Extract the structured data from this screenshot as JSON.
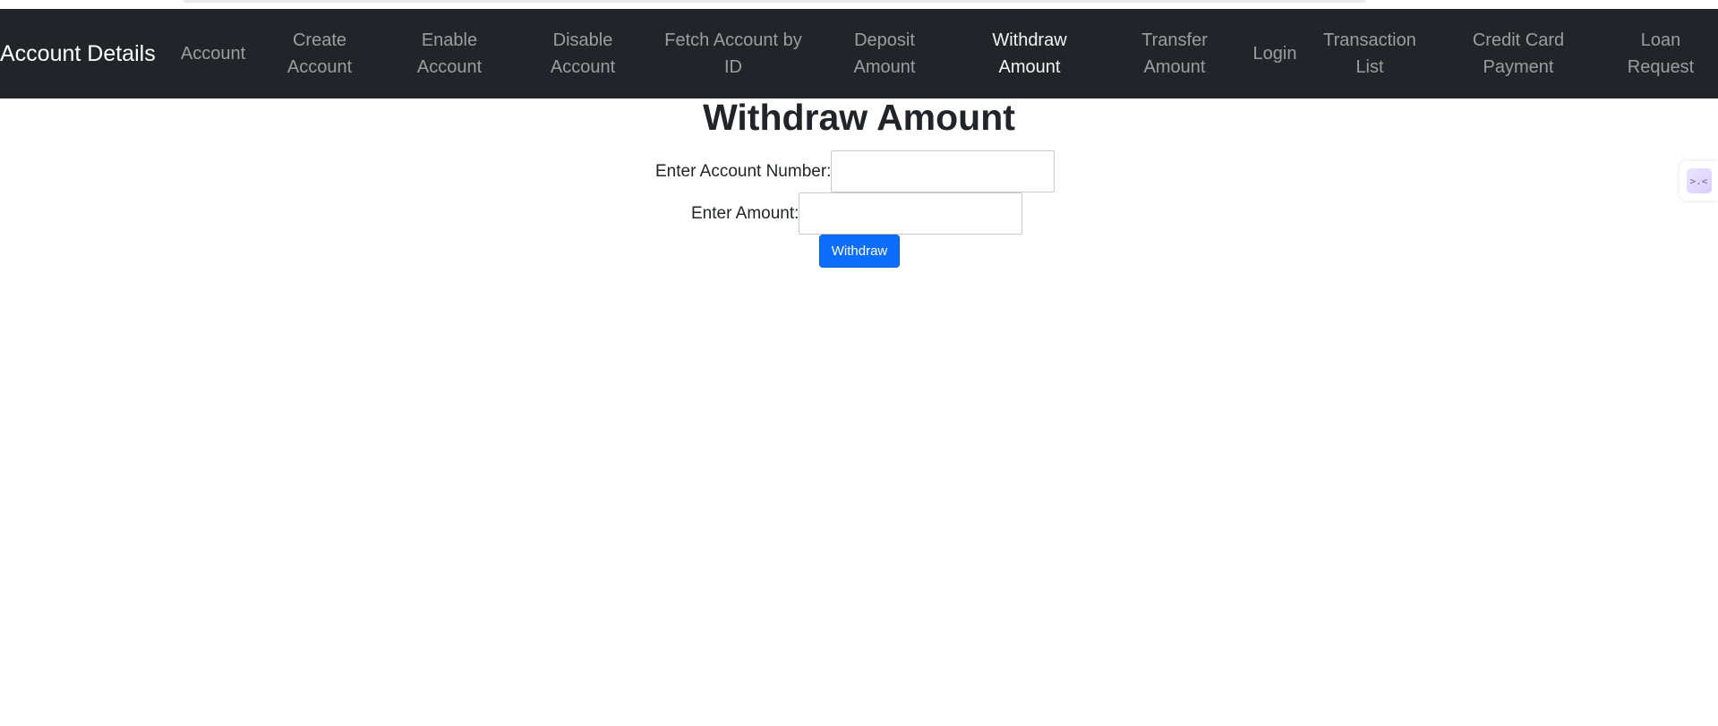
{
  "navbar": {
    "brand": "Account Details",
    "items": [
      {
        "line1": "Account",
        "line2": ""
      },
      {
        "line1": "Create",
        "line2": "Account"
      },
      {
        "line1": "Enable",
        "line2": "Account"
      },
      {
        "line1": "Disable",
        "line2": "Account"
      },
      {
        "line1": "Fetch Account by",
        "line2": "ID"
      },
      {
        "line1": "Deposit",
        "line2": "Amount"
      },
      {
        "line1": "Withdraw",
        "line2": "Amount"
      },
      {
        "line1": "Transfer",
        "line2": "Amount"
      },
      {
        "line1": "Login",
        "line2": ""
      },
      {
        "line1": "Transaction",
        "line2": "List"
      },
      {
        "line1": "Credit Card",
        "line2": "Payment"
      },
      {
        "line1": "Loan",
        "line2": "Request"
      }
    ],
    "active_index": 6
  },
  "main": {
    "title": "Withdraw Amount",
    "account_label": "Enter Account Number:",
    "account_value": "",
    "amount_label": "Enter Amount:",
    "amount_value": "",
    "submit_label": "Withdraw"
  },
  "side_widget": {
    "icon": "assistant-face-icon",
    "glyph": ">.<"
  },
  "colors": {
    "navbar_bg": "#212529",
    "primary": "#0d6efd",
    "text": "#212529"
  }
}
